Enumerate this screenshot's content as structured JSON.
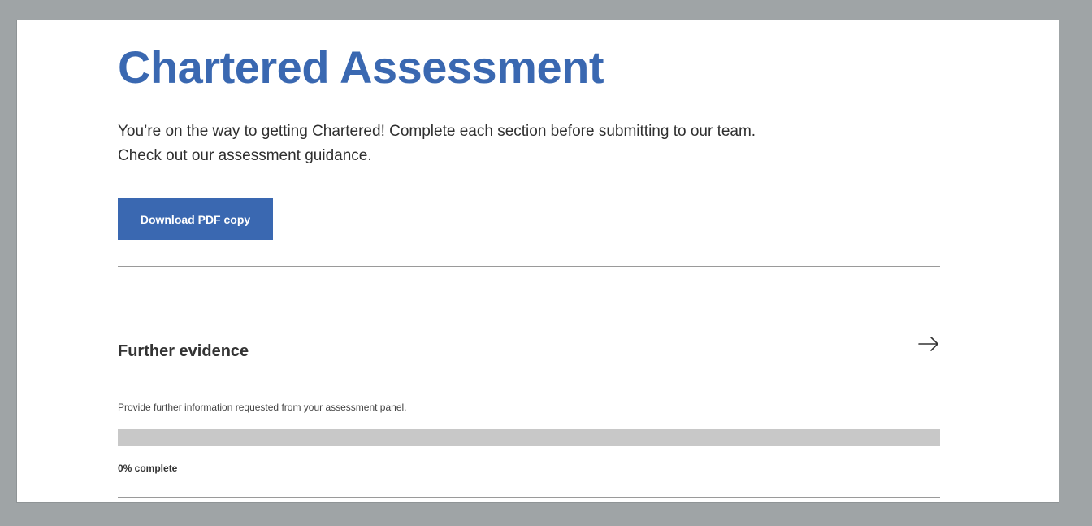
{
  "page": {
    "title": "Chartered Assessment",
    "intro": "You’re on the way to getting Chartered! Complete each section before submitting to our team.",
    "guidance_link": "Check out our assessment guidance.",
    "download_button": "Download PDF copy",
    "accent_color": "#3a68b1"
  },
  "section": {
    "title": "Further evidence",
    "description": "Provide further information requested from your assessment panel.",
    "progress_fraction": 0,
    "progress_label": "0% complete",
    "open_icon": "arrow-right-icon"
  }
}
